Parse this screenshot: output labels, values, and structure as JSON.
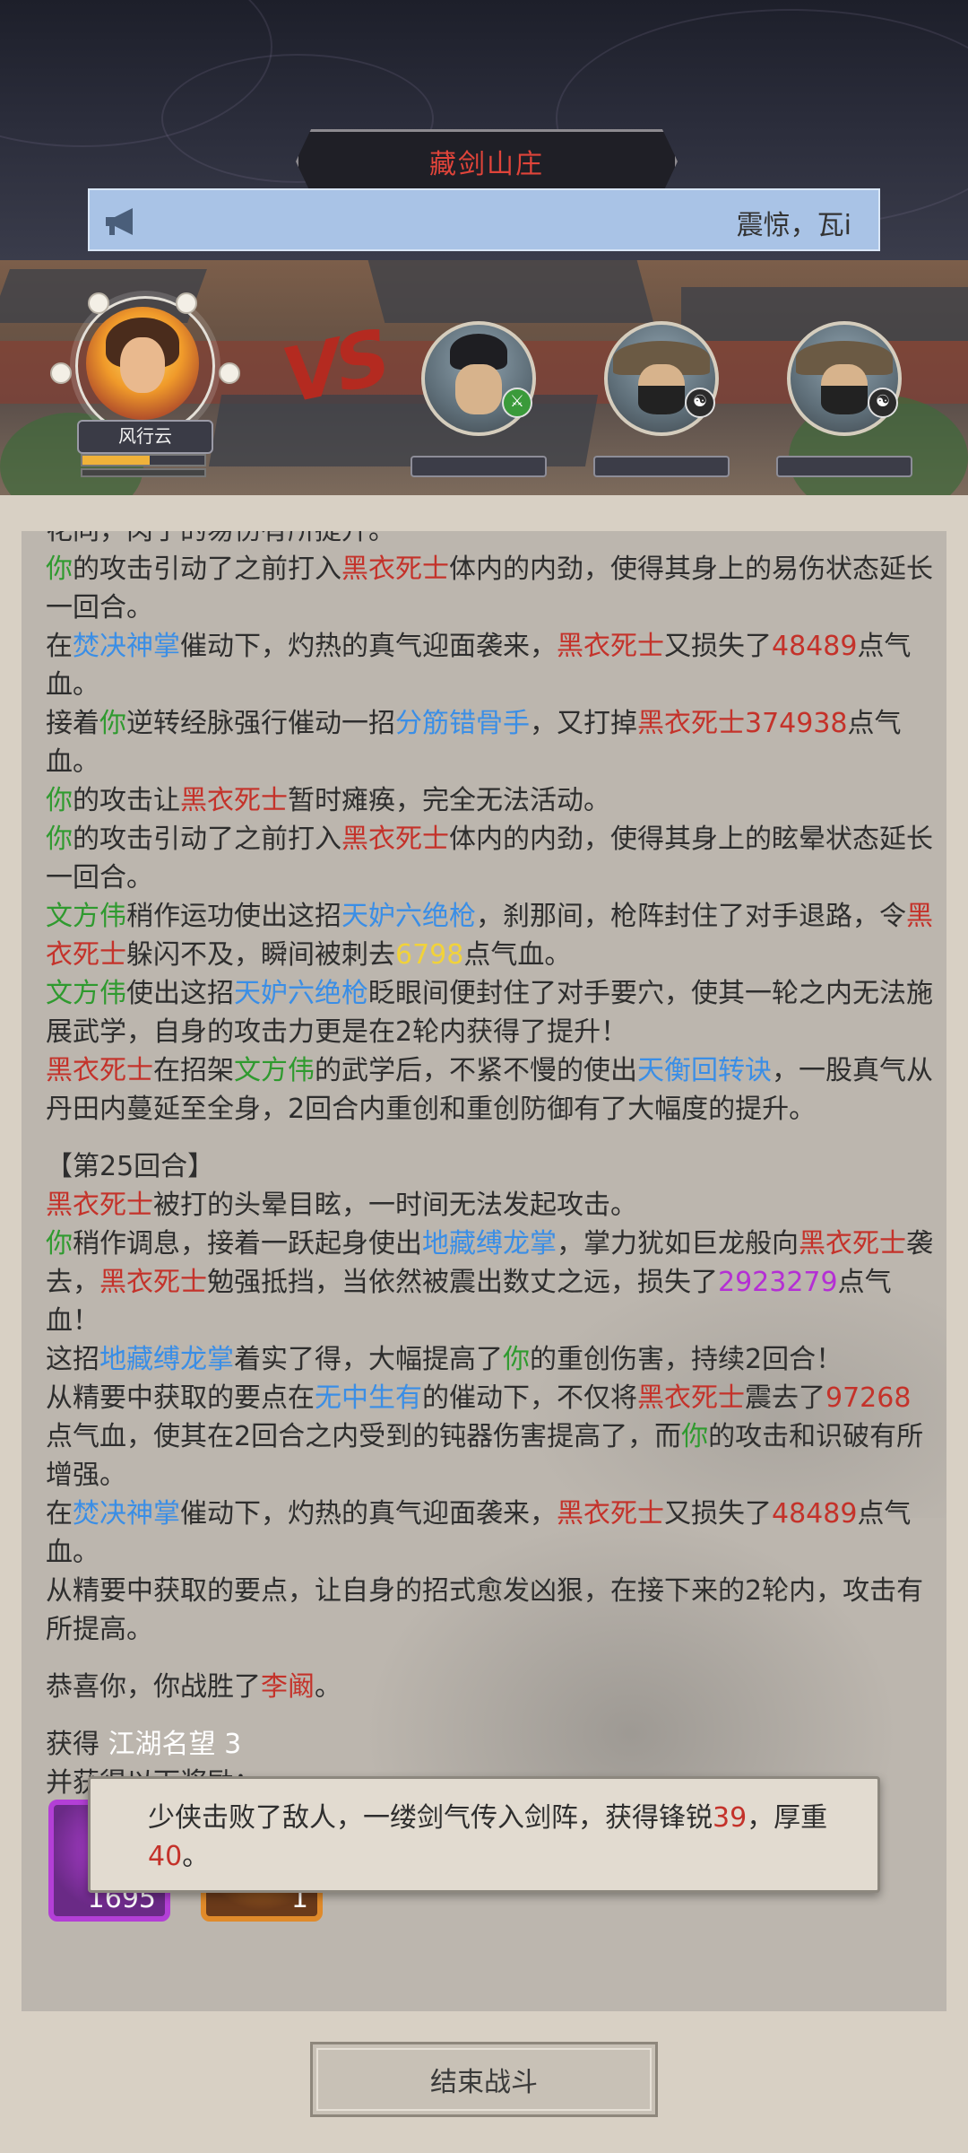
{
  "header": {
    "location_title": "藏剑山庄",
    "notice_text": "震惊，瓦i",
    "notice_icon": "megaphone-icon"
  },
  "battle": {
    "player_name": "风行云",
    "player_hp_fraction": 0.55,
    "vs_label": "VS",
    "enemies": [
      {
        "badge_icon": "sword-badge-icon"
      },
      {
        "badge_icon": "yin-yang-badge-icon"
      },
      {
        "badge_icon": "yin-yang-badge-icon"
      }
    ]
  },
  "log": {
    "partial_top": "花同，肉于的易伤有所提升。",
    "lines": [
      [
        {
          "t": "你",
          "c": "g"
        },
        {
          "t": "的攻击引动了之前打入"
        },
        {
          "t": "黑衣死士",
          "c": "r"
        },
        {
          "t": "体内的内劲，使得其身上的易伤状态延长一回合。"
        }
      ],
      [
        {
          "t": "在"
        },
        {
          "t": "焚决神掌",
          "c": "b"
        },
        {
          "t": "催动下，灼热的真气迎面袭来，"
        },
        {
          "t": "黑衣死士",
          "c": "r"
        },
        {
          "t": "又损失了"
        },
        {
          "t": "48489",
          "c": "r"
        },
        {
          "t": "点气血。"
        }
      ],
      [
        {
          "t": "接着"
        },
        {
          "t": "你",
          "c": "g"
        },
        {
          "t": "逆转经脉强行催动一招"
        },
        {
          "t": "分筋错骨手",
          "c": "b"
        },
        {
          "t": "，又打掉"
        },
        {
          "t": "黑衣死士",
          "c": "r"
        },
        {
          "t": "374938",
          "c": "r"
        },
        {
          "t": "点气血。"
        }
      ],
      [
        {
          "t": "你",
          "c": "g"
        },
        {
          "t": "的攻击让"
        },
        {
          "t": "黑衣死士",
          "c": "r"
        },
        {
          "t": "暂时瘫痪，完全无法活动。"
        }
      ],
      [
        {
          "t": "你",
          "c": "g"
        },
        {
          "t": "的攻击引动了之前打入"
        },
        {
          "t": "黑衣死士",
          "c": "r"
        },
        {
          "t": "体内的内劲，使得其身上的眩晕状态延长一回合。"
        }
      ],
      [
        {
          "t": "文方伟",
          "c": "g"
        },
        {
          "t": "稍作运功使出这招"
        },
        {
          "t": "天妒六绝枪",
          "c": "b"
        },
        {
          "t": "，刹那间，枪阵封住了对手退路，令"
        },
        {
          "t": "黑衣死士",
          "c": "r"
        },
        {
          "t": "躲闪不及，瞬间被刺去"
        },
        {
          "t": "6798",
          "c": "y"
        },
        {
          "t": "点气血。"
        }
      ],
      [
        {
          "t": "文方伟",
          "c": "g"
        },
        {
          "t": "使出这招"
        },
        {
          "t": "天妒六绝枪",
          "c": "b"
        },
        {
          "t": "眨眼间便封住了对手要穴，使其一轮之内无法施展武学，自身的攻击力更是在2轮内获得了提升！"
        }
      ],
      [
        {
          "t": "黑衣死士",
          "c": "r"
        },
        {
          "t": "在招架"
        },
        {
          "t": "文方伟",
          "c": "g"
        },
        {
          "t": "的武学后，不紧不慢的使出"
        },
        {
          "t": "天衡回转诀",
          "c": "b"
        },
        {
          "t": "，一股真气从丹田内蔓延至全身，2回合内重创和重创防御有了大幅度的提升。"
        }
      ],
      [
        {
          "t": "GAP"
        }
      ],
      [
        {
          "t": "【第25回合】"
        }
      ],
      [
        {
          "t": "黑衣死士",
          "c": "r"
        },
        {
          "t": "被打的头晕目眩，一时间无法发起攻击。"
        }
      ],
      [
        {
          "t": "你",
          "c": "g"
        },
        {
          "t": "稍作调息，接着一跃起身使出"
        },
        {
          "t": "地藏缚龙掌",
          "c": "b"
        },
        {
          "t": "，掌力犹如巨龙般向"
        },
        {
          "t": "黑衣死士",
          "c": "r"
        },
        {
          "t": "袭去，"
        },
        {
          "t": "黑衣死士",
          "c": "r"
        },
        {
          "t": "勉强抵挡，当依然被震出数丈之远，损失了"
        },
        {
          "t": "2923279",
          "c": "p"
        },
        {
          "t": "点气血！"
        }
      ],
      [
        {
          "t": "这招"
        },
        {
          "t": "地藏缚龙掌",
          "c": "b"
        },
        {
          "t": "着实了得，大幅提高了"
        },
        {
          "t": "你",
          "c": "g"
        },
        {
          "t": "的重创伤害，持续2回合！"
        }
      ],
      [
        {
          "t": "从精要中获取的要点在"
        },
        {
          "t": "无中生有",
          "c": "b"
        },
        {
          "t": "的催动下，不仅将"
        },
        {
          "t": "黑衣死士",
          "c": "r"
        },
        {
          "t": "震去了"
        },
        {
          "t": "97268",
          "c": "r"
        },
        {
          "t": "点气血，使其在2回合之内受到的钝器伤害提高了，而"
        },
        {
          "t": "你",
          "c": "g"
        },
        {
          "t": "的攻击和识破有所增强。"
        }
      ],
      [
        {
          "t": "在"
        },
        {
          "t": "焚决神掌",
          "c": "b"
        },
        {
          "t": "催动下，灼热的真气迎面袭来，"
        },
        {
          "t": "黑衣死士",
          "c": "r"
        },
        {
          "t": "又损失了"
        },
        {
          "t": "48489",
          "c": "r"
        },
        {
          "t": "点气血。"
        }
      ],
      [
        {
          "t": "从精要中获取的要点，让自身的招式愈发凶狠，在接下来的2轮内，攻击有所提高。"
        }
      ],
      [
        {
          "t": "GAP"
        }
      ],
      [
        {
          "t": "恭喜你，你战胜了"
        },
        {
          "t": "李阚",
          "c": "r"
        },
        {
          "t": "。"
        }
      ],
      [
        {
          "t": "GAP"
        }
      ]
    ],
    "reward_label": "获得",
    "reward_name": "江湖名望",
    "reward_amount": "3",
    "reward_more": "并获得以下奖励：",
    "items": [
      {
        "count": "1695",
        "border": "#b33fd6",
        "fill": "#6a2a86"
      },
      {
        "count": "1",
        "border": "#e08a2a",
        "fill": "#6a3a1a"
      }
    ]
  },
  "toast": {
    "parts": [
      {
        "t": "少侠击败了敌人，一缕剑气传入剑阵，获得锋锐"
      },
      {
        "t": "39",
        "c": "r"
      },
      {
        "t": "，厚重"
      },
      {
        "t": "40",
        "c": "r"
      },
      {
        "t": "。"
      }
    ]
  },
  "footer": {
    "end_button_label": "结束战斗"
  }
}
